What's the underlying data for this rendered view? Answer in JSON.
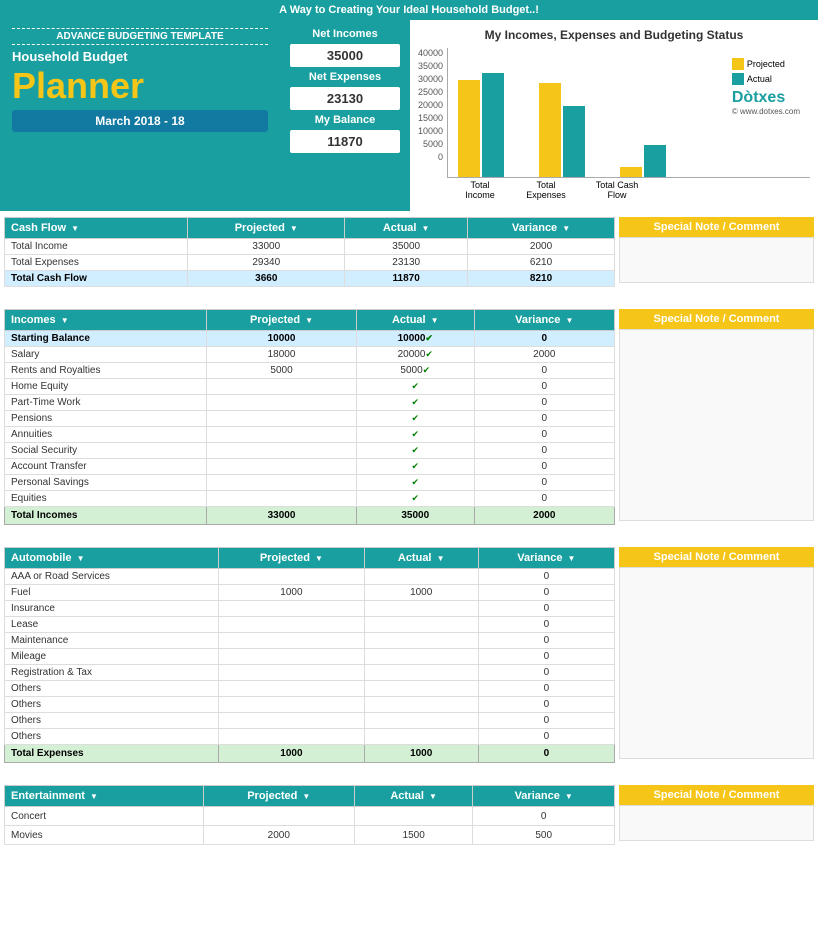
{
  "banner": "A Way to Creating Your Ideal Household Budget..!",
  "header": {
    "advance_label": "ADVANCE BUDGETING TEMPLATE",
    "planner_text": "Household Budget",
    "planner_big": "Planner",
    "date": "March 2018 - 18",
    "net_incomes_label": "Net Incomes",
    "net_incomes_value": "35000",
    "net_expenses_label": "Net Expenses",
    "net_expenses_value": "23130",
    "balance_label": "My Balance",
    "balance_value": "11870"
  },
  "chart": {
    "title": "My Incomes, Expenses and Budgeting Status",
    "y_labels": [
      "40000",
      "35000",
      "30000",
      "25000",
      "20000",
      "15000",
      "10000",
      "5000",
      "0"
    ],
    "groups": [
      {
        "label": "Total Income",
        "projected": 30000,
        "actual": 32000,
        "max": 40000
      },
      {
        "label": "Total Expenses",
        "projected": 29000,
        "actual": 22000,
        "max": 40000
      },
      {
        "label": "Total Cash Flow",
        "projected": 3000,
        "actual": 10000,
        "max": 40000
      }
    ],
    "legend": {
      "projected_label": "Projected",
      "actual_label": "Actual",
      "projected_color": "#f5c518",
      "actual_color": "#1a9fa0"
    }
  },
  "cash_flow": {
    "section_title": "Cash Flow",
    "col_projected": "Projected",
    "col_actual": "Actual",
    "col_variance": "Variance",
    "rows": [
      {
        "label": "Total Income",
        "projected": "33000",
        "actual": "35000",
        "variance": "2000"
      },
      {
        "label": "Total Expenses",
        "projected": "29340",
        "actual": "23130",
        "variance": "6210"
      },
      {
        "label": "Total Cash Flow",
        "projected": "3660",
        "actual": "11870",
        "variance": "8210"
      }
    ],
    "side_note": "Special Note / Comment"
  },
  "incomes": {
    "section_title": "Incomes",
    "col_projected": "Projected",
    "col_actual": "Actual",
    "col_variance": "Variance",
    "rows": [
      {
        "label": "Starting Balance",
        "projected": "10000",
        "actual": "10000",
        "variance": "0",
        "highlight": true
      },
      {
        "label": "Salary",
        "projected": "18000",
        "actual": "20000",
        "variance": "2000"
      },
      {
        "label": "Rents and Royalties",
        "projected": "5000",
        "actual": "5000",
        "variance": "0"
      },
      {
        "label": "Home Equity",
        "projected": "",
        "actual": "",
        "variance": "0"
      },
      {
        "label": "Part-Time Work",
        "projected": "",
        "actual": "",
        "variance": "0"
      },
      {
        "label": "Pensions",
        "projected": "",
        "actual": "",
        "variance": "0"
      },
      {
        "label": "Annuities",
        "projected": "",
        "actual": "",
        "variance": "0"
      },
      {
        "label": "Social Security",
        "projected": "",
        "actual": "",
        "variance": "0"
      },
      {
        "label": "Account Transfer",
        "projected": "",
        "actual": "",
        "variance": "0"
      },
      {
        "label": "Personal Savings",
        "projected": "",
        "actual": "",
        "variance": "0"
      },
      {
        "label": "Equities",
        "projected": "",
        "actual": "",
        "variance": "0"
      }
    ],
    "total_row": {
      "label": "Total Incomes",
      "projected": "33000",
      "actual": "35000",
      "variance": "2000"
    },
    "side_note": "Special Note / Comment"
  },
  "automobile": {
    "section_title": "Automobile",
    "col_projected": "Projected",
    "col_actual": "Actual",
    "col_variance": "Variance",
    "rows": [
      {
        "label": "AAA or Road Services",
        "projected": "",
        "actual": "",
        "variance": "0"
      },
      {
        "label": "Fuel",
        "projected": "1000",
        "actual": "1000",
        "variance": "0"
      },
      {
        "label": "Insurance",
        "projected": "",
        "actual": "",
        "variance": "0"
      },
      {
        "label": "Lease",
        "projected": "",
        "actual": "",
        "variance": "0"
      },
      {
        "label": "Maintenance",
        "projected": "",
        "actual": "",
        "variance": "0"
      },
      {
        "label": "Mileage",
        "projected": "",
        "actual": "",
        "variance": "0"
      },
      {
        "label": "Registration & Tax",
        "projected": "",
        "actual": "",
        "variance": "0"
      },
      {
        "label": "Others",
        "projected": "",
        "actual": "",
        "variance": "0"
      },
      {
        "label": "Others",
        "projected": "",
        "actual": "",
        "variance": "0"
      },
      {
        "label": "Others",
        "projected": "",
        "actual": "",
        "variance": "0"
      },
      {
        "label": "Others",
        "projected": "",
        "actual": "",
        "variance": "0"
      }
    ],
    "total_row": {
      "label": "Total  Expenses",
      "projected": "1000",
      "actual": "1000",
      "variance": "0"
    },
    "side_note": "Special Note / Comment"
  },
  "entertainment": {
    "section_title": "Entertainment",
    "col_projected": "Projected",
    "col_actual": "Actual",
    "col_variance": "Variance",
    "rows": [
      {
        "label": "Concert",
        "projected": "",
        "actual": "",
        "variance": "0"
      },
      {
        "label": "Movies",
        "projected": "2000",
        "actual": "1500",
        "variance": "500"
      }
    ],
    "side_note": "Special Note / Comment"
  },
  "dotxes": "Dotxes",
  "website": "© www.dotxes.com"
}
